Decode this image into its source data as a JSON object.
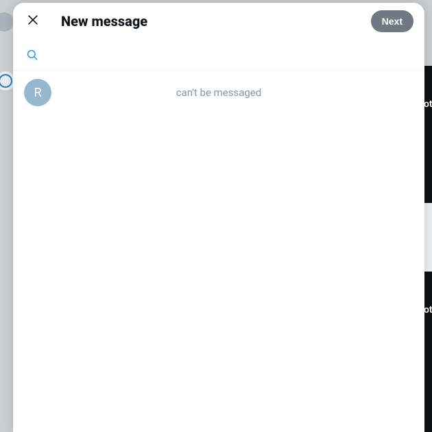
{
  "header": {
    "title": "New message",
    "next_label": "Next"
  },
  "search": {
    "value": "",
    "placeholder": ""
  },
  "results": [
    {
      "avatar_initial": "R",
      "status_text": "can't be messaged"
    }
  ],
  "background": {
    "peek_text_1": "ot",
    "peek_text_2": "ot"
  }
}
